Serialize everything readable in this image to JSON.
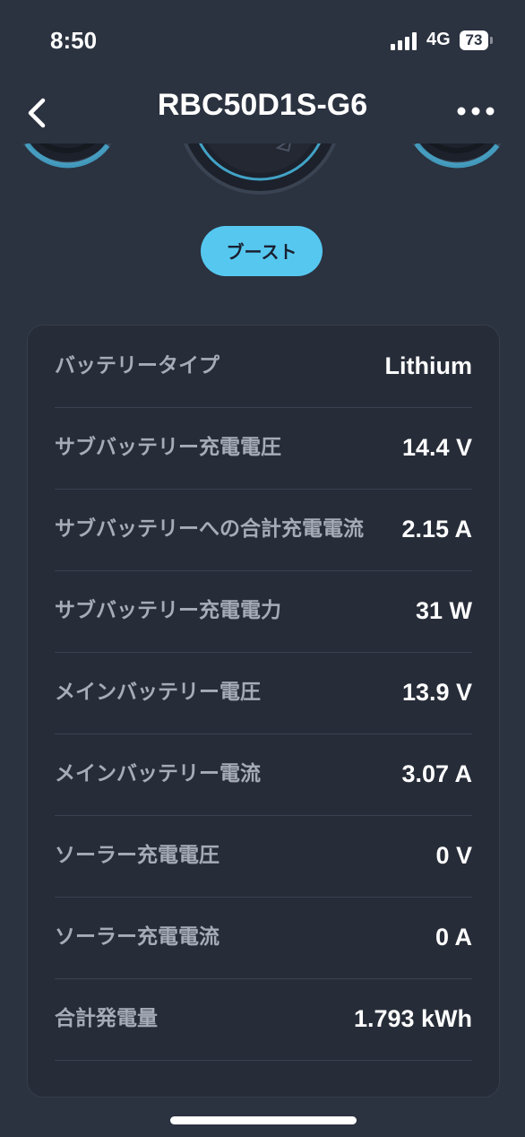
{
  "status_bar": {
    "time": "8:50",
    "network": "4G",
    "battery": "73"
  },
  "nav": {
    "title": "RBC50D1S-G6",
    "back_icon": "chevron-left-icon",
    "more_icon": "more-horizontal-icon"
  },
  "mode_button": {
    "label": "ブースト",
    "color": "#56c8f0"
  },
  "details": [
    {
      "label": "バッテリータイプ",
      "value": "Lithium"
    },
    {
      "label": "サブバッテリー充電電圧",
      "value": "14.4 V"
    },
    {
      "label": "サブバッテリーへの合計充電電流",
      "value": "2.15 A"
    },
    {
      "label": "サブバッテリー充電電力",
      "value": "31 W"
    },
    {
      "label": "メインバッテリー電圧",
      "value": "13.9 V"
    },
    {
      "label": "メインバッテリー電流",
      "value": "3.07 A"
    },
    {
      "label": "ソーラー充電電圧",
      "value": "0 V"
    },
    {
      "label": "ソーラー充電電流",
      "value": "0 A"
    },
    {
      "label": "合計発電量",
      "value": "1.793 kWh"
    }
  ],
  "colors": {
    "background": "#2b3240",
    "card": "#262c38",
    "accent": "#56c8f0"
  }
}
